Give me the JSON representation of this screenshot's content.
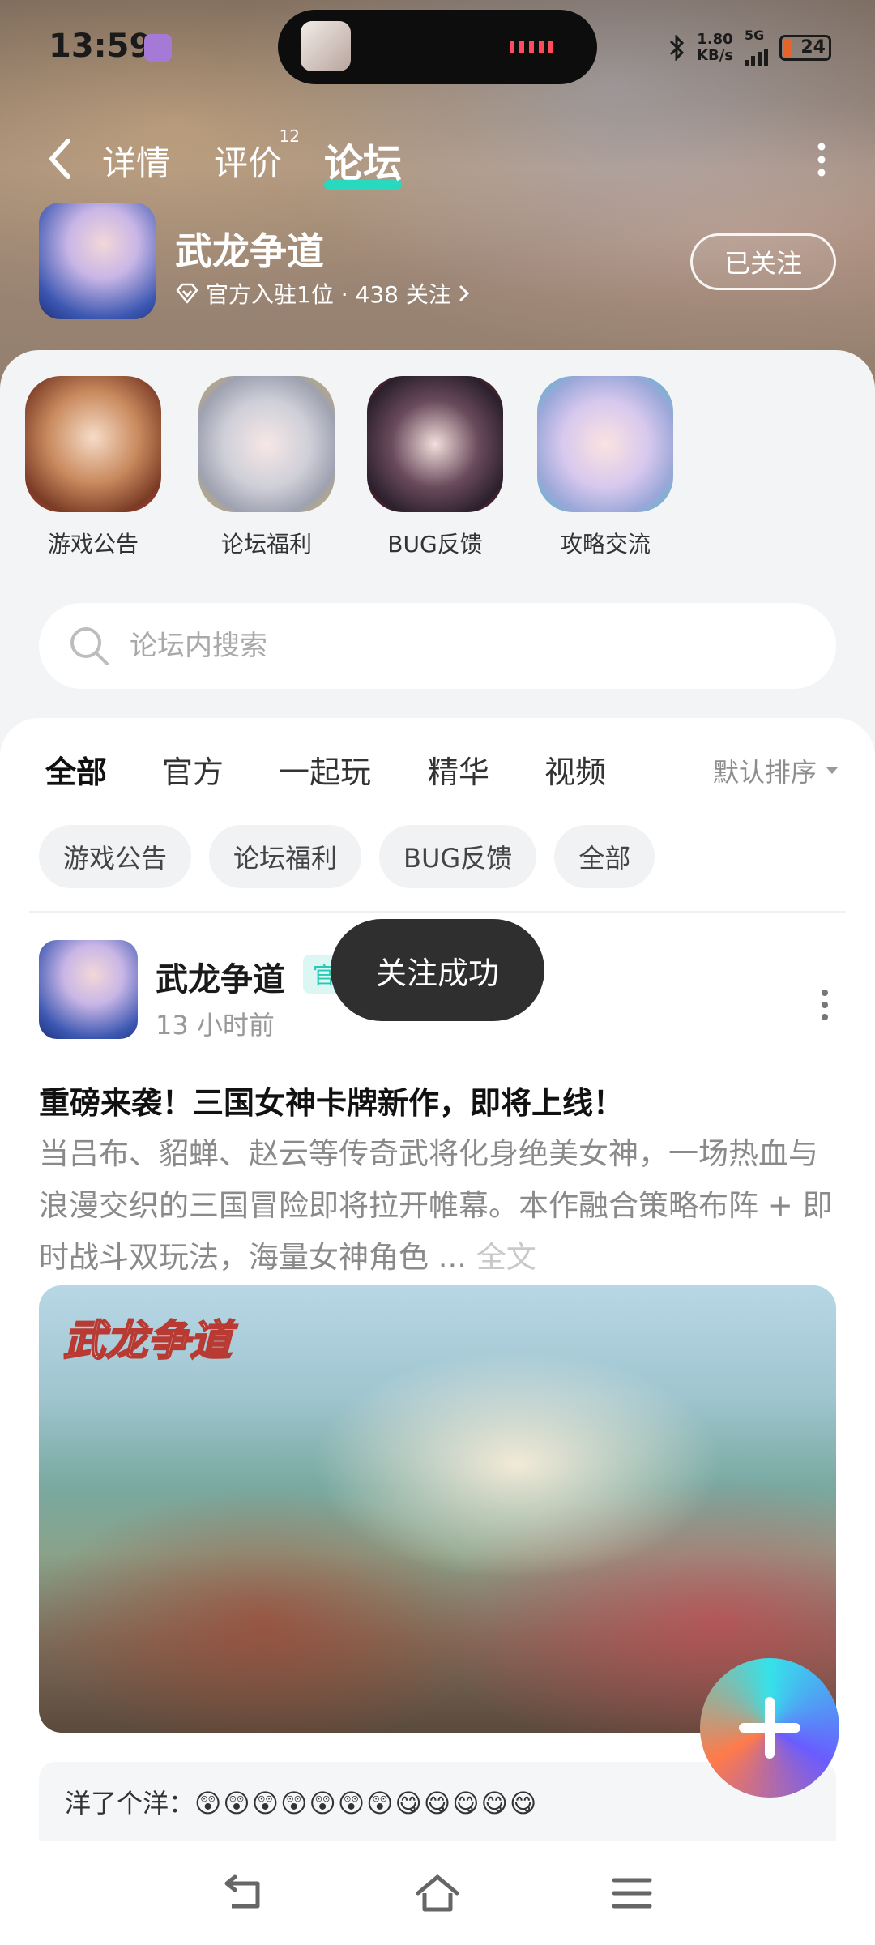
{
  "status_bar": {
    "time": "13:59",
    "net_speed_value": "1.80",
    "net_speed_unit": "KB/s",
    "network": "5G",
    "battery": "24"
  },
  "nav": {
    "tabs": [
      {
        "label": "详情",
        "active": false
      },
      {
        "label": "评价",
        "badge": "12",
        "active": false
      },
      {
        "label": "论坛",
        "active": true
      }
    ]
  },
  "game": {
    "title": "武龙争道",
    "meta": "官方入驻1位 · 438 关注",
    "follow_label": "已关注"
  },
  "sections": [
    {
      "label": "游戏公告"
    },
    {
      "label": "论坛福利"
    },
    {
      "label": "BUG反馈"
    },
    {
      "label": "攻略交流"
    }
  ],
  "search": {
    "placeholder": "论坛内搜索"
  },
  "feed_tabs": [
    "全部",
    "官方",
    "一起玩",
    "精华",
    "视频"
  ],
  "sort_label": "默认排序",
  "chips": [
    "游戏公告",
    "论坛福利",
    "BUG反馈",
    "全部"
  ],
  "post": {
    "author": "武龙争道",
    "tag": "官",
    "time": "13 小时前",
    "title": "重磅来袭！三国女神卡牌新作，即将上线！",
    "body": "当吕布、貂蝉、赵云等传奇武将化身绝美女神，一场热血与浪漫交织的三国冒险即将拉开帷幕。本作融合策略布阵 + 即时战斗双玩法，海量女神角色 ...",
    "full_label": "全文",
    "image_logo": "武龙争道"
  },
  "comment": {
    "user": "洋了个洋：",
    "emojis": "😲😲😲😲😲😲😲😋😋😋😋😋"
  },
  "toast": "关注成功",
  "colors": {
    "accent": "#28d9c0",
    "tag_text": "#28c9b3"
  }
}
